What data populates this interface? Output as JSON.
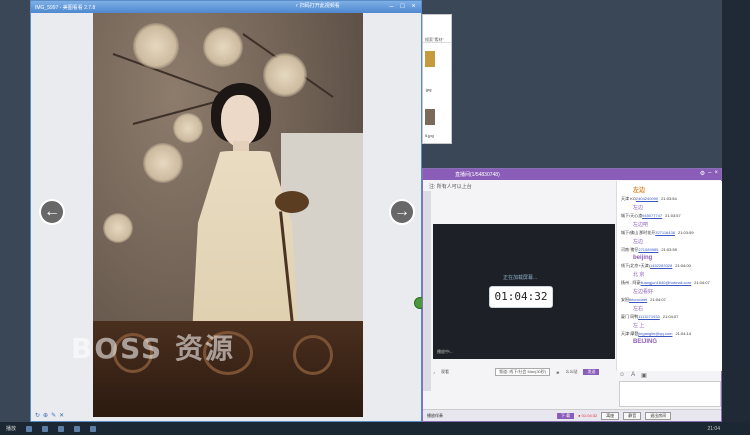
{
  "viewer": {
    "title": "IMG_5997 - 美图看看 2.7.8",
    "sound_label": "ꜥ 扫码打开此视频看",
    "watermark": "BOSS 资源",
    "prev_icon": "←",
    "next_icon": "→"
  },
  "explorer": {
    "addr": "搜索\"素材\"",
    "files": [
      ".jpg",
      ".jpg",
      "5.jpg"
    ]
  },
  "live": {
    "title": "直播间(1/54830748)",
    "notice": "注: 所有人可以上台",
    "loading": "正在加载屏幕...",
    "clock": "01:04:32",
    "video_caption": "播放中/...",
    "toolbar": {
      "view_label": "观看",
      "channel": "线下/社会 Max(30秒)",
      "channel_select": "频道: 线下/社会 Max(30秒)",
      "flower": "么么哒",
      "send": "发送"
    },
    "chat": [
      {
        "type": "msg",
        "text": "左边",
        "cls": "big orange"
      },
      {
        "type": "row",
        "name": "天津 KO",
        "link": "2404240090",
        "time": "21:03:54"
      },
      {
        "type": "msg",
        "text": "左边"
      },
      {
        "type": "row",
        "name": "城下/天心渣",
        "link": "945077747",
        "time": "21:03:57"
      },
      {
        "type": "msg",
        "text": "左边吧"
      },
      {
        "type": "row",
        "name": "城下/佛山 那时花开",
        "link": "327116438",
        "time": "21:03:59"
      },
      {
        "type": "msg",
        "text": "左边"
      },
      {
        "type": "row",
        "name": "河南·猪仔",
        "link": "271089985",
        "time": "21:03:59"
      },
      {
        "type": "msg",
        "text": "beijing",
        "cls": "big"
      },
      {
        "type": "row",
        "name": "线下(北京+天津)",
        "link": "1452283328",
        "time": "21:04:00"
      },
      {
        "type": "msg",
        "text": "北 京"
      },
      {
        "type": "row",
        "name": "扬州 - 阿豪",
        "link": "liuangjun1840@hotmail.com",
        "time": "21:04:07"
      },
      {
        "type": "msg",
        "text": "左边看好"
      },
      {
        "type": "row",
        "name": "安阳",
        "link": "tbtcrocwet",
        "time": "21:04:07"
      },
      {
        "type": "msg",
        "text": "左右"
      },
      {
        "type": "row",
        "name": "厦门 同鸭",
        "link": "1113271933",
        "time": "21:04:07"
      },
      {
        "type": "msg",
        "text": "左 上"
      },
      {
        "type": "row",
        "name": "天津·摩登",
        "link": "jinganglin@qq.com",
        "time": "21:04:14"
      },
      {
        "type": "msg",
        "text": "BEIJING",
        "cls": "big"
      }
    ],
    "bottom": {
      "play": "播放伴奏",
      "down": "下 载",
      "rec": "● 01:04:32",
      "b1": "离座",
      "b2": "静音",
      "b3": "退出房间"
    }
  },
  "taskbar": {
    "start": "播放",
    "time": "21:04"
  }
}
